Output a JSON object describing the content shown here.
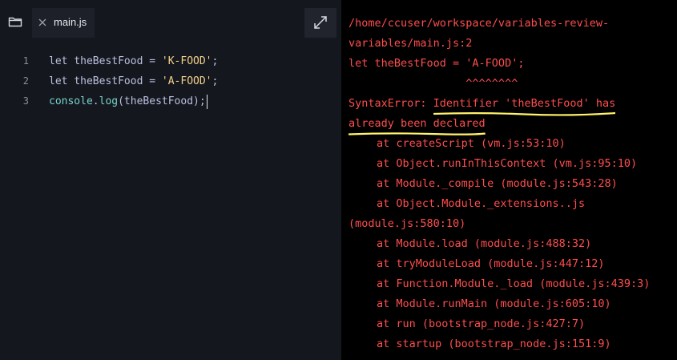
{
  "editor": {
    "tab_label": "main.js",
    "lines": [
      {
        "num": "1",
        "kw": "let ",
        "ident": "theBestFood",
        "op": " = ",
        "str": "'K-FOOD'",
        "end": ";"
      },
      {
        "num": "2",
        "kw": "let ",
        "ident": "theBestFood",
        "op": " = ",
        "str": "'A-FOOD'",
        "end": ";"
      },
      {
        "num": "3",
        "obj": "console",
        "dot": ".",
        "fn": "log",
        "args": "(theBestFood);"
      }
    ]
  },
  "console": {
    "lines": [
      "/home/ccuser/workspace/variables-review-",
      "variables/main.js:2",
      "let theBestFood = 'A-FOOD';",
      "                  ^^^^^^^^",
      "at createScript (vm.js:53:10)",
      "at Object.runInThisContext (vm.js:95:10)",
      "at Module._compile (module.js:543:28)",
      "at Object.Module._extensions..js",
      "(module.js:580:10)",
      "at Module.load (module.js:488:32)",
      "at tryModuleLoad (module.js:447:12)",
      "at Function.Module._load (module.js:439:3)",
      "at Module.runMain (module.js:605:10)",
      "at run (bootstrap_node.js:427:7)",
      "at startup (bootstrap_node.js:151:9)"
    ],
    "error_prefix": "SyntaxError: ",
    "error_part1": "Identifier 'theBestFood' has",
    "error_part2": "already been declared"
  },
  "colors": {
    "editor_bg": "#15171f",
    "console_bg": "#000000",
    "error_red": "#ff4d4d",
    "highlight_yellow": "#fff36b",
    "string_yellow": "#f2d28b",
    "function_teal": "#76d3c8"
  },
  "icons": {
    "folder": "folder-icon",
    "close": "close-icon",
    "expand": "expand-icon"
  }
}
